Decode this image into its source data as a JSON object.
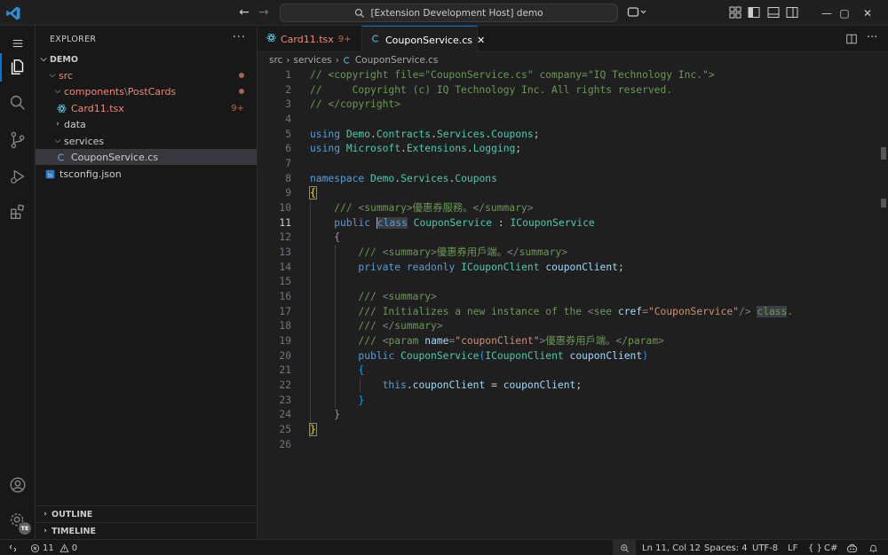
{
  "titlebar": {
    "search_text": "[Extension Development Host] demo",
    "window_controls": [
      "minimize",
      "maximize",
      "close"
    ]
  },
  "sidebar": {
    "title": "EXPLORER",
    "more": "···",
    "root": "DEMO",
    "tree": [
      {
        "label": "src",
        "indent": 1,
        "type": "folder",
        "open": true,
        "status": "modified"
      },
      {
        "label": "components",
        "sep": "\\",
        "label2": "PostCards",
        "indent": 2,
        "type": "folder",
        "open": true,
        "status": "modified"
      },
      {
        "label": "Card11.tsx",
        "indent": 3,
        "type": "react",
        "badge": "9+"
      },
      {
        "label": "data",
        "indent": 2,
        "type": "folder",
        "open": false
      },
      {
        "label": "services",
        "indent": 2,
        "type": "folder",
        "open": true
      },
      {
        "label": "CouponService.cs",
        "indent": 3,
        "type": "csharp",
        "selected": true
      },
      {
        "label": "tsconfig.json",
        "indent": 1,
        "type": "ts"
      }
    ],
    "outline_label": "OUTLINE",
    "timeline_label": "TIMELINE"
  },
  "tabs": [
    {
      "label": "Card11.tsx",
      "badge": "9+"
    },
    {
      "label": "CouponService.cs",
      "close": "✕"
    }
  ],
  "breadcrumb": [
    "src",
    "services",
    "CouponService.cs"
  ],
  "editor": {
    "current_line": 11,
    "lines": [
      "1",
      "2",
      "3",
      "4",
      "5",
      "6",
      "7",
      "8",
      "9",
      "10",
      "11",
      "12",
      "13",
      "14",
      "15",
      "16",
      "17",
      "18",
      "19",
      "20",
      "21",
      "22",
      "23",
      "24",
      "25",
      "26"
    ]
  },
  "statusbar": {
    "errors": "11",
    "warnings": "0",
    "position": "Ln 11, Col 12",
    "spaces": "Spaces: 4",
    "encoding": "UTF-8",
    "eol": "LF",
    "braces": "{ }",
    "language": "C#"
  },
  "colors": {
    "accent": "#0078d4",
    "modified": "#f48771",
    "warning_badge": "#cc6633"
  }
}
